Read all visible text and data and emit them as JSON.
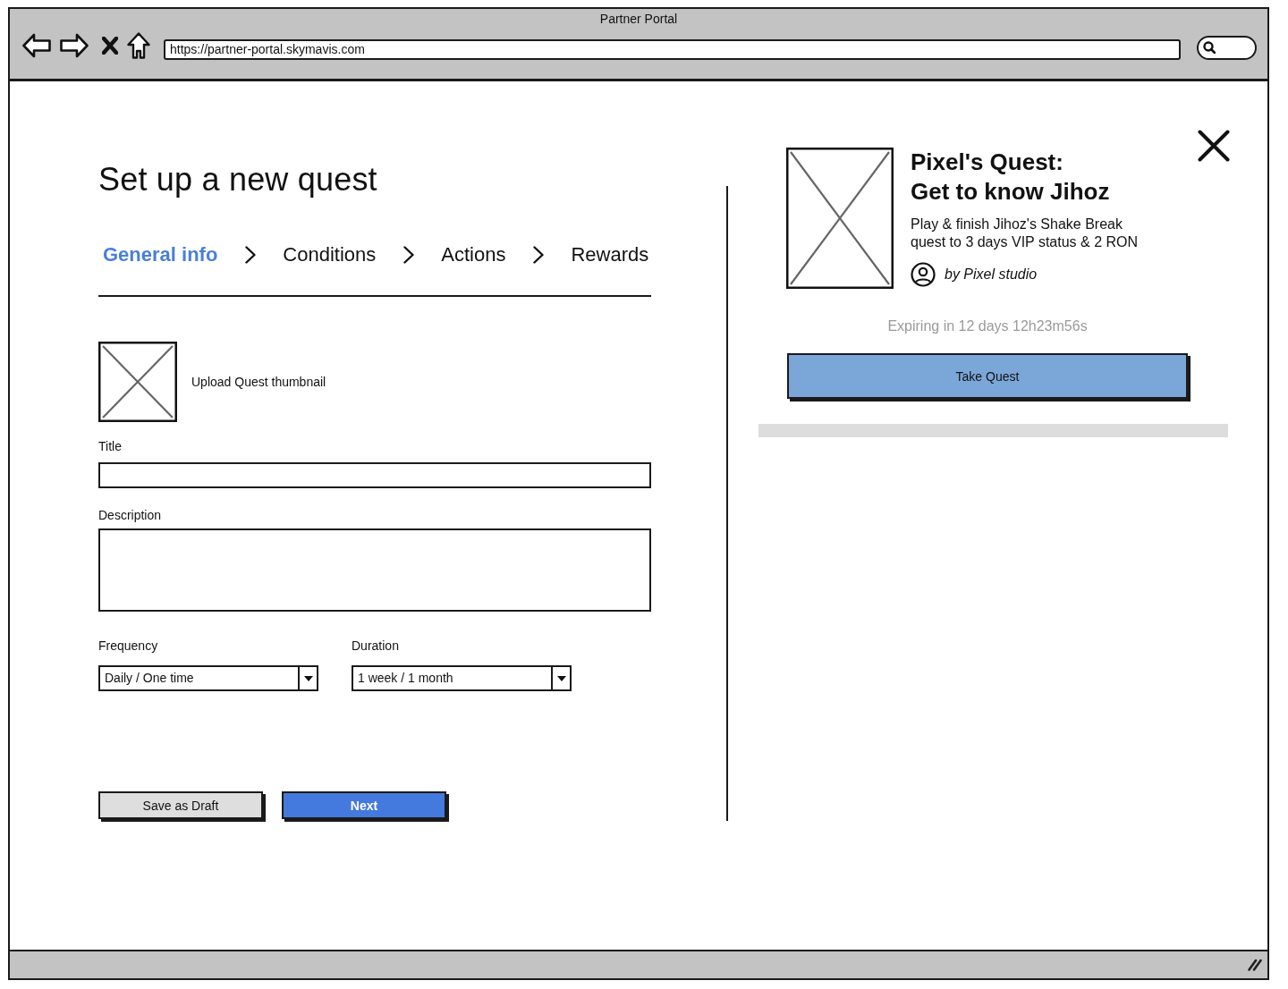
{
  "window": {
    "title": "Partner Portal",
    "url": "https://partner-portal.skymavis.com"
  },
  "form": {
    "heading": "Set up a new quest",
    "steps": [
      {
        "label": "General info",
        "selected": true
      },
      {
        "label": "Conditions",
        "selected": false
      },
      {
        "label": "Actions",
        "selected": false
      },
      {
        "label": "Rewards",
        "selected": false
      }
    ],
    "thumbnail": {
      "label": "Upload Quest thumbnail"
    },
    "fields": [
      {
        "kind": "input",
        "label": "Title"
      },
      {
        "kind": "textarea",
        "label": "Description"
      }
    ],
    "selects": [
      {
        "label": "Frequency",
        "value": "Daily / One time"
      },
      {
        "label": "Duration",
        "value": "1 week / 1 month"
      }
    ],
    "buttons": [
      {
        "kind": "secondary",
        "label": "Save as Draft"
      },
      {
        "kind": "primary",
        "label": "Next"
      }
    ]
  },
  "preview": {
    "title": "Pixel's Quest:\nGet to know Jihoz",
    "description": "Play & finish Jihoz's Shake Break quest to 3 days VIP status & 2 RON",
    "author": "by Pixel studio",
    "expiry": "Expiring in 12 days 12h23m56s",
    "button": "Take Quest"
  }
}
